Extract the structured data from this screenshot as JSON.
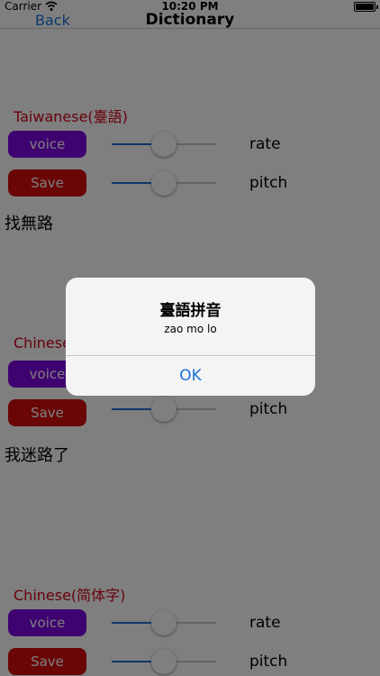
{
  "status_bar": {
    "carrier": "Carrier",
    "time": "10:20 PM"
  },
  "nav": {
    "back_label": "Back",
    "title": "Dictionary"
  },
  "sections": [
    {
      "title": "Taiwanese(臺語)",
      "voice_label": "voice",
      "save_label": "Save",
      "rate_label": "rate",
      "pitch_label": "pitch",
      "rate_value": 0.5,
      "pitch_value": 0.5,
      "phrase": "找無路"
    },
    {
      "title": "Chinese",
      "voice_label": "voice",
      "save_label": "Save",
      "pitch_label": "pitch",
      "rate_value": 0.5,
      "pitch_value": 0.5,
      "phrase": "我迷路了"
    },
    {
      "title": "Chinese(简体字)",
      "voice_label": "voice",
      "save_label": "Save",
      "rate_label": "rate",
      "pitch_label": "pitch",
      "rate_value": 0.5,
      "pitch_value": 0.5
    }
  ],
  "alert": {
    "title": "臺語拼音",
    "message": "zao mo lo",
    "ok_label": "OK"
  },
  "colors": {
    "accent": "#1d6fd8",
    "voice_button": "#7c06e0",
    "save_button": "#d40c0c",
    "section_title": "#d0021b",
    "slider_min_track": "#1f6fd0"
  }
}
